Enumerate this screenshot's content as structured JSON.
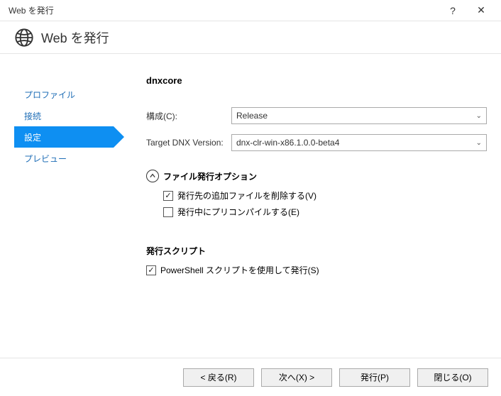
{
  "titlebar": {
    "title": "Web を発行"
  },
  "header": {
    "title": "Web を発行"
  },
  "sidebar": {
    "items": [
      {
        "label": "プロファイル"
      },
      {
        "label": "接続"
      },
      {
        "label": "設定"
      },
      {
        "label": "プレビュー"
      }
    ]
  },
  "main": {
    "profile_name": "dnxcore",
    "config_label": "構成(C):",
    "config_value": "Release",
    "dnx_label": "Target DNX Version:",
    "dnx_value": "dnx-clr-win-x86.1.0.0-beta4",
    "file_options_title": "ファイル発行オプション",
    "delete_extra_label": "発行先の追加ファイルを削除する(V)",
    "precompile_label": "発行中にプリコンパイルする(E)",
    "scripts_title": "発行スクリプト",
    "powershell_label": "PowerShell スクリプトを使用して発行(S)"
  },
  "footer": {
    "back": "< 戻る(R)",
    "next": "次へ(X) >",
    "publish": "発行(P)",
    "close": "閉じる(O)"
  }
}
